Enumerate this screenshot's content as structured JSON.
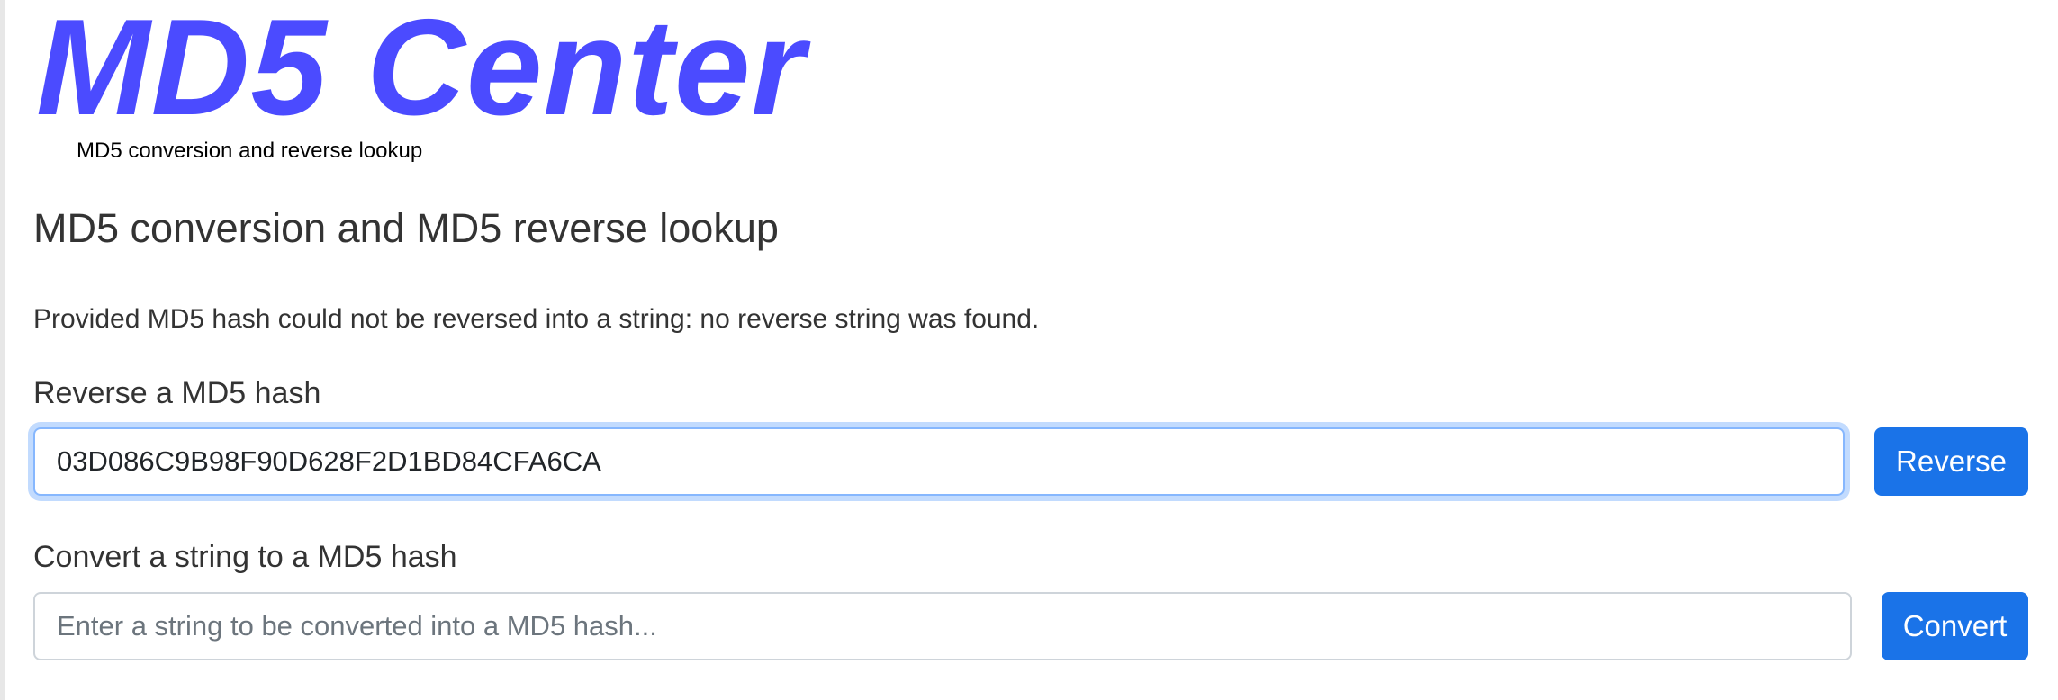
{
  "header": {
    "logo_text": "MD5 Center",
    "tagline": "MD5 conversion and reverse lookup"
  },
  "main": {
    "title": "MD5 conversion and MD5 reverse lookup",
    "status_message": "Provided MD5 hash could not be reversed into a string: no reverse string was found.",
    "reverse": {
      "label": "Reverse a MD5 hash",
      "value": "03D086C9B98F90D628F2D1BD84CFA6CA",
      "button_label": "Reverse"
    },
    "convert": {
      "label": "Convert a string to a MD5 hash",
      "value": "",
      "placeholder": "Enter a string to be converted into a MD5 hash...",
      "button_label": "Convert"
    }
  },
  "colors": {
    "logo": "#4b4bff",
    "button": "#1a73e8",
    "focus_border": "#86b7fe",
    "text": "#333333"
  }
}
